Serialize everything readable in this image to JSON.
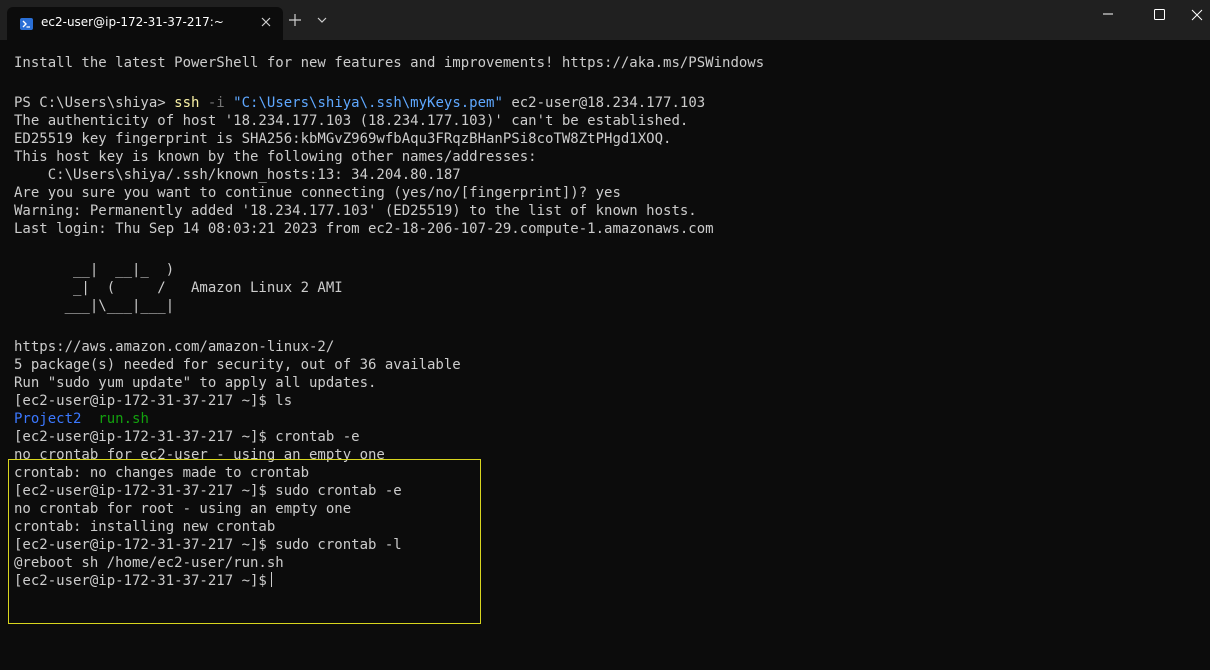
{
  "window": {
    "tab_title": "ec2-user@ip-172-31-37-217:~",
    "icons": {
      "tab": "powershell-icon",
      "close_tab": "close-icon",
      "new_tab": "plus-icon",
      "dropdown": "chevron-down-icon",
      "minimize": "minimize-icon",
      "maximize": "maximize-icon",
      "close": "close-icon"
    }
  },
  "terminal": {
    "install_msg": "Install the latest PowerShell for new features and improvements! https://aka.ms/PSWindows",
    "ps_prompt": "PS C:\\Users\\shiya> ",
    "ssh_cmd": "ssh",
    "ssh_flag": " -i ",
    "ssh_key": "\"C:\\Users\\shiya\\.ssh\\myKeys.pem\"",
    "ssh_target": " ec2-user@18.234.177.103",
    "auth_line": "The authenticity of host '18.234.177.103 (18.234.177.103)' can't be established.",
    "fingerprint_line": "ED25519 key fingerprint is SHA256:kbMGvZ969wfbAqu3FRqzBHanPSi8coTW8ZtPHgd1XOQ.",
    "known_line": "This host key is known by the following other names/addresses:",
    "known_hosts_line": "    C:\\Users\\shiya/.ssh/known_hosts:13: 34.204.80.187",
    "continue_line": "Are you sure you want to continue connecting (yes/no/[fingerprint])? yes",
    "warning_line": "Warning: Permanently added '18.234.177.103' (ED25519) to the list of known hosts.",
    "last_login_line": "Last login: Thu Sep 14 08:03:21 2023 from ec2-18-206-107-29.compute-1.amazonaws.com",
    "ascii_1": "       __|  __|_  )",
    "ascii_2": "       _|  (     /   Amazon Linux 2 AMI",
    "ascii_3": "      ___|\\___|___|",
    "url_line": "https://aws.amazon.com/amazon-linux-2/",
    "packages_line": "5 package(s) needed for security, out of 36 available",
    "update_line": "Run \"sudo yum update\" to apply all updates.",
    "prompt_ls": "[ec2-user@ip-172-31-37-217 ~]$ ls",
    "ls_dir": "Project2",
    "ls_sep": "  ",
    "ls_file": "run.sh",
    "crontab_e": "[ec2-user@ip-172-31-37-217 ~]$ crontab -e",
    "no_crontab_user": "no crontab for ec2-user - using an empty one",
    "no_changes": "crontab: no changes made to crontab",
    "sudo_crontab_e": "[ec2-user@ip-172-31-37-217 ~]$ sudo crontab -e",
    "no_crontab_root": "no crontab for root - using an empty one",
    "installing": "crontab: installing new crontab",
    "sudo_crontab_l": "[ec2-user@ip-172-31-37-217 ~]$ sudo crontab -l",
    "reboot_line": "@reboot sh /home/ec2-user/run.sh",
    "final_prompt": "[ec2-user@ip-172-31-37-217 ~]$"
  }
}
